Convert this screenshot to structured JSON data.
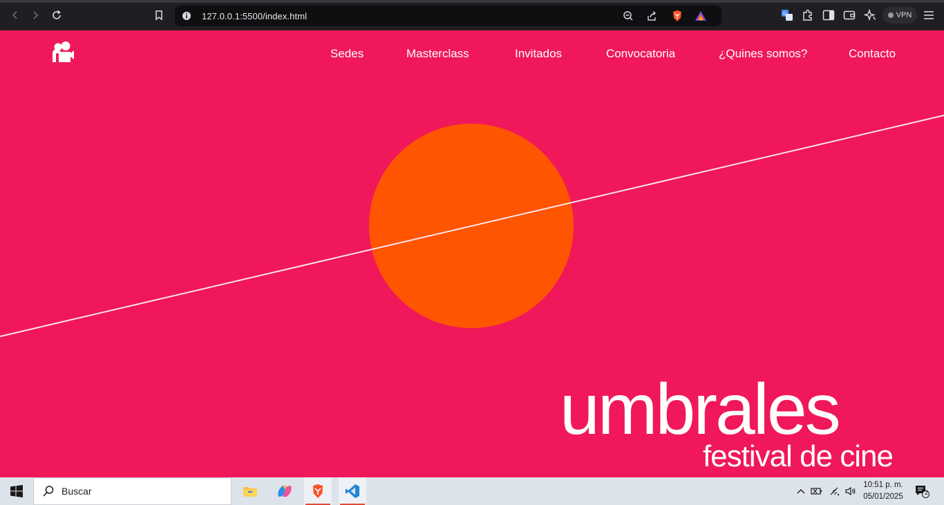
{
  "browser": {
    "url": "127.0.0.1:5500/index.html",
    "vpn_label": "VPN"
  },
  "site": {
    "nav": [
      {
        "label": "Sedes"
      },
      {
        "label": "Masterclass"
      },
      {
        "label": "Invitados"
      },
      {
        "label": "Convocatoria"
      },
      {
        "label": "¿Quines somos?"
      },
      {
        "label": "Contacto"
      }
    ],
    "brand_word": "umbrales",
    "brand_subtitle": "festival de cine",
    "colors": {
      "background": "#f0185a",
      "circle": "#ff5500",
      "line": "#ffe8ee"
    }
  },
  "taskbar": {
    "search_label": "Buscar",
    "time": "10:51 p. m.",
    "date": "05/01/2025",
    "notification_count": "2",
    "apps": [
      {
        "name": "file-explorer"
      },
      {
        "name": "copilot"
      },
      {
        "name": "brave-browser"
      },
      {
        "name": "vscode"
      }
    ]
  }
}
